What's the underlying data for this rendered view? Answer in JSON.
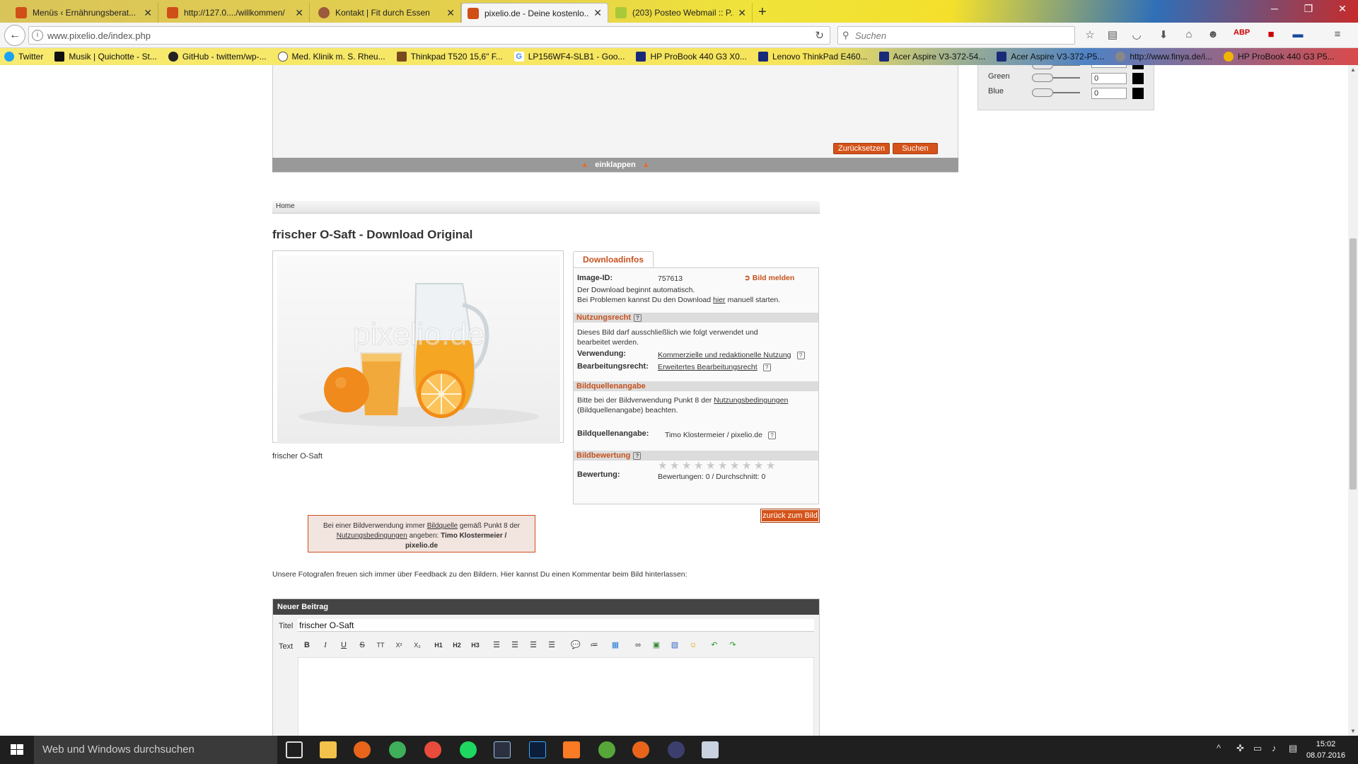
{
  "browser": {
    "tabs": [
      {
        "title": "Menüs ‹ Ernährungsberat...",
        "icon_color": "#d04e17"
      },
      {
        "title": "http://127.0..../willkommen/",
        "icon_color": "#d04e17"
      },
      {
        "title": "Kontakt | Fit durch Essen",
        "icon_color": "#9c5a3c"
      },
      {
        "title": "pixelio.de - Deine kostenlo...",
        "icon_color": "#d04e17"
      },
      {
        "title": "(203) Posteo Webmail :: P...",
        "icon_color": "#a8c93a"
      }
    ],
    "url": "www.pixelio.de/index.php",
    "search_placeholder": "Suchen",
    "bookmarks": [
      {
        "label": "Twitter",
        "icon_color": "#1da1f2"
      },
      {
        "label": "Musik | Quichotte - St...",
        "icon_color": "#111111"
      },
      {
        "label": "GitHub - twittem/wp-...",
        "icon_color": "#222222"
      },
      {
        "label": "Med. Klinik m. S. Rheu...",
        "icon_color": "#ffffff"
      },
      {
        "label": "Thinkpad T520 15,6\" F...",
        "icon_color": "#7a4a1f"
      },
      {
        "label": "LP156WF4-SLB1 - Goo...",
        "icon_color": "#4285f4"
      },
      {
        "label": "HP ProBook 440 G3 X0...",
        "icon_color": "#1a2a7a"
      },
      {
        "label": "Lenovo ThinkPad E460...",
        "icon_color": "#1a2a7a"
      },
      {
        "label": "Acer Aspire V3-372-54...",
        "icon_color": "#1a2a7a"
      },
      {
        "label": "Acer Aspire V3-372-P5...",
        "icon_color": "#1a2a7a"
      },
      {
        "label": "http://www.finya.de/i...",
        "icon_color": "#888888"
      },
      {
        "label": "HP ProBook 440 G3 P5...",
        "icon_color": "#f0b400"
      }
    ]
  },
  "colorfilter": {
    "rows": [
      {
        "label": "Green",
        "value": "0"
      },
      {
        "label": "Blue",
        "value": "0"
      }
    ],
    "reset_label": "Zurücksetzen",
    "search_label": "Suchen",
    "collapse_label": "einklappen"
  },
  "breadcrumb": "Home",
  "page_title": "frischer O-Saft - Download Original",
  "photo_caption": "frischer O-Saft",
  "watermark": "pixelio.de",
  "downloadinfo": {
    "tab_label": "Downloadinfos",
    "image_id_label": "Image-ID:",
    "image_id": "757613",
    "report_label": "Bild melden",
    "auto_text": "Der Download beginnt automatisch.",
    "manual_pre": "Bei Problemen kannst Du den Download",
    "manual_link": "hier",
    "manual_post": "manuell starten.",
    "usage_head": "Nutzungsrecht",
    "usage_text": "Dieses Bild darf ausschließlich wie folgt verwendet und bearbeitet werden.",
    "use_label": "Verwendung:",
    "use_value": "Kommerzielle und redaktionelle Nutzung",
    "edit_label": "Bearbeitungsrecht:",
    "edit_value": "Erweitertes Bearbeitungsrecht",
    "credit_head": "Bildquellenangabe",
    "credit_text_pre": "Bitte bei der Bildverwendung Punkt 8 der",
    "credit_link": "Nutzungsbedingungen",
    "credit_text_post": "(Bildquellenangabe) beachten.",
    "credit_label": "Bildquellenangabe:",
    "credit_value": "Timo Klostermeier  / pixelio.de",
    "rating_head": "Bildbewertung",
    "rating_label": "Bewertung:",
    "rating_stats": "Bewertungen: 0 / Durchschnitt: 0",
    "rating_value": 0,
    "back_label": "zurück zum Bild"
  },
  "notice": {
    "pre": "Bei einer Bildverwendung immer",
    "link1": "Bildquelle",
    "mid": "gemäß Punkt 8 der",
    "link2": "Nutzungsbedingungen",
    "post": "angeben:",
    "credit": "Timo Klostermeier  /",
    "credit2": "pixelio.de"
  },
  "feedback_text": "Unsere Fotografen freuen sich immer über Feedback zu den Bildern. Hier kannst Du einen Kommentar beim Bild hinterlassen:",
  "editor": {
    "header": "Neuer Beitrag",
    "title_label": "Titel",
    "title_value": "frischer O-Saft",
    "text_label": "Text",
    "toolbar": [
      "B",
      "I",
      "U",
      "S",
      "TT",
      "X²",
      "X₂",
      "H1",
      "H2",
      "H3"
    ]
  },
  "taskbar": {
    "search_placeholder": "Web und Windows durchsuchen",
    "time": "15:02",
    "date": "08.07.2016"
  }
}
